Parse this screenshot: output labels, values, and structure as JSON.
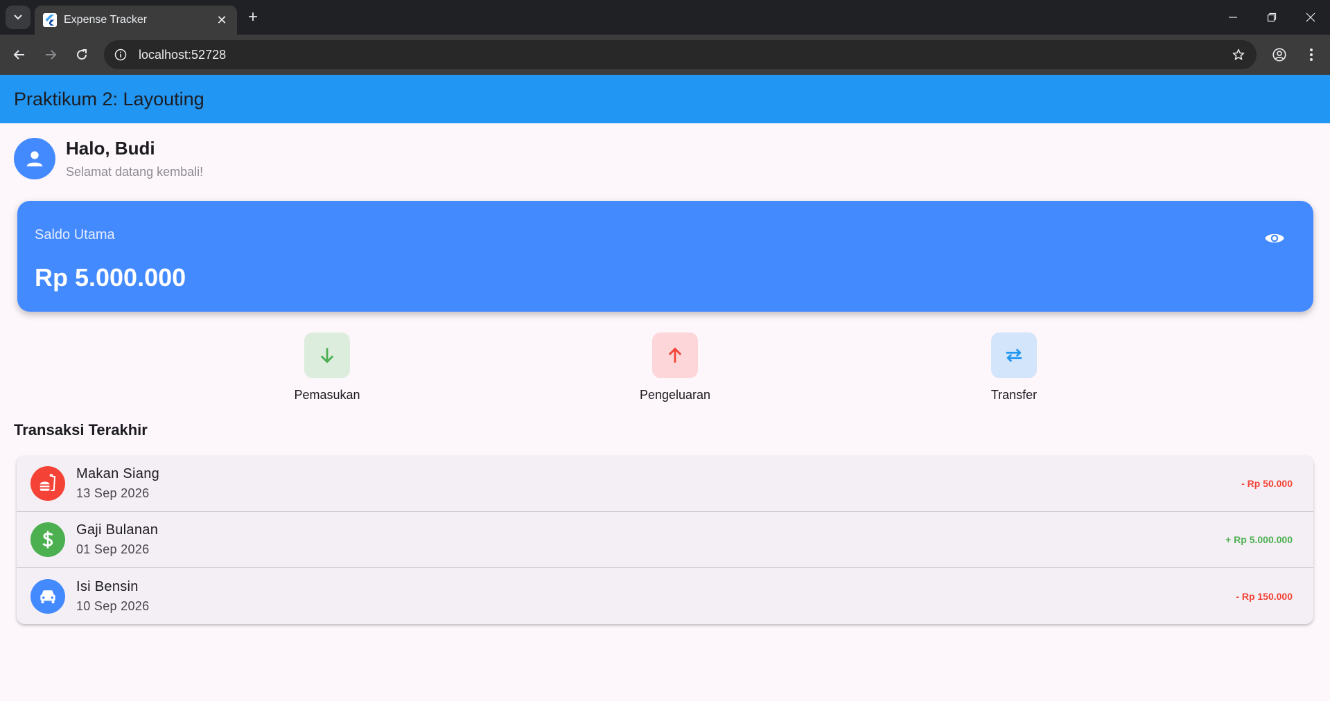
{
  "browser": {
    "tab_title": "Expense Tracker",
    "url": "localhost:52728"
  },
  "app": {
    "title": "Praktikum 2: Layouting",
    "greeting": {
      "name": "Halo, Budi",
      "subtitle": "Selamat datang kembali!"
    },
    "balance": {
      "label": "Saldo Utama",
      "amount": "Rp 5.000.000"
    },
    "actions": [
      {
        "label": "Pemasukan",
        "icon": "arrow-down-icon",
        "color": "#4caf50",
        "bg": "#dcedde"
      },
      {
        "label": "Pengeluaran",
        "icon": "arrow-up-icon",
        "color": "#f44336",
        "bg": "#fcd6d8"
      },
      {
        "label": "Transfer",
        "icon": "swap-icon",
        "color": "#2196f3",
        "bg": "#d3e5fb"
      }
    ],
    "section_title": "Transaksi Terakhir",
    "transactions": [
      {
        "title": "Makan Siang",
        "date": "13 Sep 2026",
        "amount": "- Rp 50.000",
        "icon": "fastfood-icon",
        "color": "#f44336"
      },
      {
        "title": "Gaji Bulanan",
        "date": "01 Sep 2026",
        "amount": "+ Rp 5.000.000",
        "icon": "dollar-icon",
        "color": "#4caf50"
      },
      {
        "title": "Isi Bensin",
        "date": "10 Sep 2026",
        "amount": "- Rp 150.000",
        "icon": "car-icon",
        "color": "#448aff"
      }
    ]
  },
  "colors": {
    "appbar": "#2196f3",
    "card": "#448aff",
    "background": "#fdf7fc"
  }
}
